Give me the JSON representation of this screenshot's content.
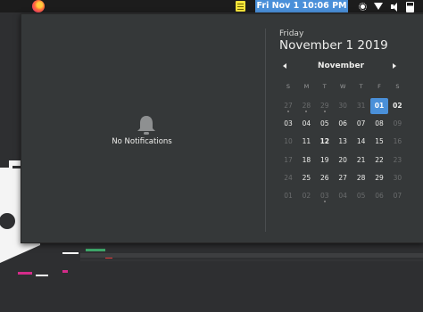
{
  "topbar": {
    "clock": "Fri Nov  1  10:06 PM",
    "app_icon": "firefox-icon",
    "notes_icon": "notes-icon",
    "tray_icons": [
      "brightness-icon",
      "wifi-icon",
      "volume-icon",
      "battery-icon"
    ]
  },
  "notifications": {
    "empty_text": "No Notifications",
    "icon": "bell-icon"
  },
  "calendar": {
    "weekday": "Friday",
    "full_date": "November 1 2019",
    "month": "November",
    "day_headers": [
      "S",
      "M",
      "T",
      "W",
      "T",
      "F",
      "S"
    ],
    "weeks": [
      [
        {
          "d": "27",
          "dim": true,
          "dot": true
        },
        {
          "d": "28",
          "dim": true,
          "dot": true
        },
        {
          "d": "29",
          "dim": true,
          "dot": true
        },
        {
          "d": "30",
          "dim": true
        },
        {
          "d": "31",
          "dim": true
        },
        {
          "d": "01",
          "sel": true
        },
        {
          "d": "02",
          "bold": true
        }
      ],
      [
        {
          "d": "03"
        },
        {
          "d": "04"
        },
        {
          "d": "05"
        },
        {
          "d": "06"
        },
        {
          "d": "07"
        },
        {
          "d": "08"
        },
        {
          "d": "09",
          "dim": true
        }
      ],
      [
        {
          "d": "10",
          "dim": true
        },
        {
          "d": "11"
        },
        {
          "d": "12",
          "bold": true
        },
        {
          "d": "13"
        },
        {
          "d": "14"
        },
        {
          "d": "15"
        },
        {
          "d": "16",
          "dim": true
        }
      ],
      [
        {
          "d": "17",
          "dim": true
        },
        {
          "d": "18"
        },
        {
          "d": "19"
        },
        {
          "d": "20"
        },
        {
          "d": "21"
        },
        {
          "d": "22"
        },
        {
          "d": "23",
          "dim": true
        }
      ],
      [
        {
          "d": "24",
          "dim": true
        },
        {
          "d": "25"
        },
        {
          "d": "26"
        },
        {
          "d": "27"
        },
        {
          "d": "28"
        },
        {
          "d": "29"
        },
        {
          "d": "30",
          "dim": true
        }
      ],
      [
        {
          "d": "01",
          "dim": true
        },
        {
          "d": "02",
          "dim": true
        },
        {
          "d": "03",
          "dim": true,
          "dot": true
        },
        {
          "d": "04",
          "dim": true
        },
        {
          "d": "05",
          "dim": true
        },
        {
          "d": "06",
          "dim": true
        },
        {
          "d": "07",
          "dim": true
        }
      ]
    ]
  },
  "colors": {
    "accent": "#4a90d9",
    "popup_bg": "#353839",
    "topbar_bg": "#1c1c1c"
  }
}
